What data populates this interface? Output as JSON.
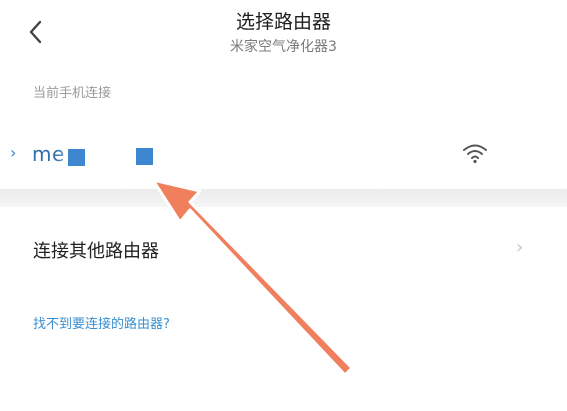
{
  "header": {
    "title": "选择路由器",
    "subtitle": "米家空气净化器3"
  },
  "current": {
    "section_label": "当前手机连接",
    "ssid_visible": "me"
  },
  "other": {
    "label": "连接其他路由器"
  },
  "help_link": "找不到要连接的路由器?",
  "colors": {
    "accent_blue": "#3a83c6",
    "annotation_arrow": "#f07f5e"
  },
  "icons": {
    "back": "back-chevron-icon",
    "expand": "expand-chevron-icon",
    "wifi": "wifi-icon",
    "row_arrow": "chevron-right-icon"
  }
}
